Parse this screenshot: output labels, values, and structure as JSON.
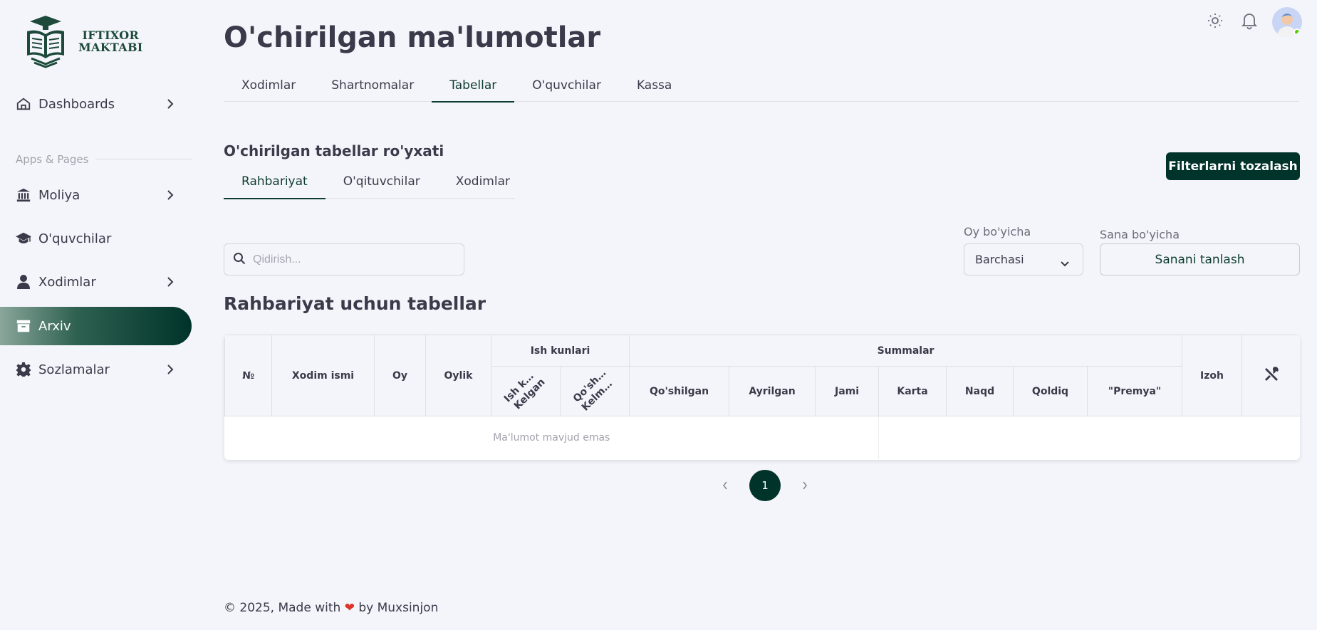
{
  "brand": {
    "line1": "IFTIXOR",
    "line2": "MAKTABI"
  },
  "sidebar": {
    "section_label": "Apps & Pages",
    "items": [
      {
        "label": "Dashboards",
        "icon": "home-icon"
      },
      {
        "label": "Moliya",
        "icon": "bank-icon"
      },
      {
        "label": "O'quvchilar",
        "icon": "graduation-cap-icon"
      },
      {
        "label": "Xodimlar",
        "icon": "user-icon"
      },
      {
        "label": "Arxiv",
        "icon": "archive-icon"
      },
      {
        "label": "Sozlamalar",
        "icon": "gear-icon"
      }
    ]
  },
  "header": {
    "title": "O'chirilgan ma'lumotlar"
  },
  "tabs": [
    "Xodimlar",
    "Shartnomalar",
    "Tabellar",
    "O'quvchilar",
    "Kassa"
  ],
  "subsection": {
    "title": "O'chirilgan tabellar ro'yxati",
    "tabs": [
      "Rahbariyat",
      "O'qituvchilar",
      "Xodimlar"
    ]
  },
  "actions": {
    "clear_filters": "Filterlarni tozalash"
  },
  "filters": {
    "search_placeholder": "Qidirish...",
    "month_label": "Oy bo'yicha",
    "month_value": "Barchasi",
    "date_label": "Sana bo'yicha",
    "date_button": "Sanani tanlash"
  },
  "table": {
    "title": "Rahbariyat uchun tabellar",
    "headers": {
      "num": "№",
      "name": "Xodim ismi",
      "month": "Oy",
      "salary": "Oylik",
      "workdays": "Ish kunlari",
      "workdays_sub": [
        [
          "Ish ku...",
          "Kelgan"
        ],
        [
          "Qo'sh...",
          "Kelma..."
        ]
      ],
      "sums": "Summalar",
      "sums_sub": [
        "Qo'shilgan",
        "Ayrilgan",
        "Jami",
        "Karta",
        "Naqd",
        "Qoldiq",
        "\"Premya\""
      ],
      "note": "Izoh"
    },
    "empty": "Ma'lumot mavjud emas"
  },
  "pagination": {
    "current": "1"
  },
  "footer": {
    "prefix": "© 2025, Made with",
    "heart": "❤",
    "suffix": "by Muxsinjon"
  },
  "colors": {
    "accent": "#00332a",
    "background": "#f4f5fa",
    "text": "#3b3a4a"
  }
}
